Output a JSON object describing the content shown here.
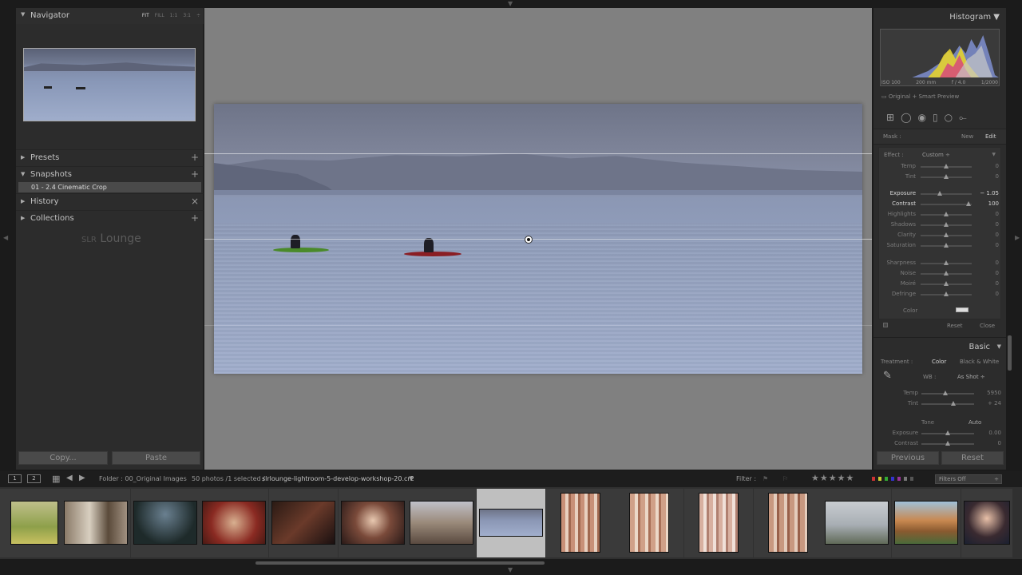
{
  "navigator": {
    "title": "Navigator",
    "zoom_fit": "FIT",
    "zoom_fill": "FILL",
    "zoom_1_1": "1:1",
    "zoom_3_1": "3:1"
  },
  "left_panels": {
    "presets": "Presets",
    "snapshots": "Snapshots",
    "snapshot_item": "01 - 2.4 Cinematic Crop",
    "history": "History",
    "collections": "Collections",
    "add_symbol": "+",
    "close_symbol": "×"
  },
  "logo": {
    "bracket": "SLR",
    "text": "Lounge"
  },
  "left_buttons": {
    "copy": "Copy...",
    "paste": "Paste"
  },
  "histogram": {
    "title": "Histogram",
    "iso": "ISO 100",
    "focal": "200 mm",
    "aperture": "f / 4.0",
    "shutter": "1/2000",
    "preview": "Original + Smart Preview"
  },
  "mask": {
    "label": "Mask :",
    "new": "New",
    "edit": "Edit"
  },
  "effect": {
    "label": "Effect :",
    "preset": "Custom ÷",
    "sliders": [
      {
        "name": "Temp",
        "value": "0",
        "pos": 0.5
      },
      {
        "name": "Tint",
        "value": "0",
        "pos": 0.5
      },
      {
        "name": "Exposure",
        "value": "− 1.05",
        "pos": 0.37,
        "active": true
      },
      {
        "name": "Contrast",
        "value": "100",
        "pos": 0.93,
        "active": true
      },
      {
        "name": "Highlights",
        "value": "0",
        "pos": 0.5
      },
      {
        "name": "Shadows",
        "value": "0",
        "pos": 0.5
      },
      {
        "name": "Clarity",
        "value": "0",
        "pos": 0.5
      },
      {
        "name": "Saturation",
        "value": "0",
        "pos": 0.5
      },
      {
        "name": "Sharpness",
        "value": "0",
        "pos": 0.5
      },
      {
        "name": "Noise",
        "value": "0",
        "pos": 0.5
      },
      {
        "name": "Moiré",
        "value": "0",
        "pos": 0.5
      },
      {
        "name": "Defringe",
        "value": "0",
        "pos": 0.5
      }
    ],
    "color_label": "Color",
    "reset": "Reset",
    "close": "Close"
  },
  "basic": {
    "title": "Basic",
    "treatment_label": "Treatment :",
    "treatment_color": "Color",
    "treatment_bw": "Black & White",
    "wb_label": "WB :",
    "wb_value": "As Shot ÷",
    "temp_label": "Temp",
    "temp_value": "5950",
    "temp_pos": 0.45,
    "tint_label": "Tint",
    "tint_value": "+ 24",
    "tint_pos": 0.6,
    "tone_label": "Tone",
    "auto": "Auto",
    "exposure_label": "Exposure",
    "exposure_value": "0.00",
    "exposure_pos": 0.5,
    "contrast_label": "Contrast",
    "contrast_value": "0",
    "contrast_pos": 0.5
  },
  "right_buttons": {
    "previous": "Previous",
    "reset": "Reset"
  },
  "filmstrip_bar": {
    "monitor1": "1",
    "monitor2": "2",
    "folder": "Folder : 00_Original Images",
    "count": "50 photos /1 selected /",
    "filename": "slrlounge-lightroom-5-develop-workshop-20.cr2",
    "filter_label": "Filter :",
    "stars": "★★★★★",
    "filters_off": "Filters Off"
  },
  "colors": {
    "accent_select": "#bfbfbf",
    "panel": "#2c2c2c",
    "canvas": "#808080"
  }
}
